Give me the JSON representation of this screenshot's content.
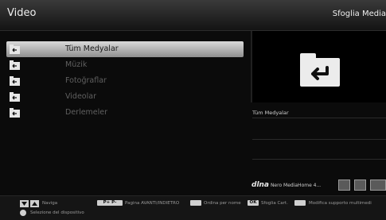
{
  "header": {
    "title": "Video",
    "right": "Sfoglia Media"
  },
  "menu": [
    {
      "label": "Tüm Medyalar",
      "selected": true
    },
    {
      "label": "Müzik",
      "selected": false
    },
    {
      "label": "Fotoğraflar",
      "selected": false
    },
    {
      "label": "Videolar",
      "selected": false
    },
    {
      "label": "Derlemeler",
      "selected": false
    }
  ],
  "preview": {
    "title": "Tüm Medyalar"
  },
  "dlna": {
    "brand": "dlna",
    "server": "Nero MediaHome 4..."
  },
  "footer": {
    "navigate": "Naviga",
    "pminus_key": "P+ P-",
    "page": "Pagina AVANTI/INDIETRO",
    "sort": "Ordina per nome",
    "ok_key": "OK",
    "browse": "Sfoglia Cart.",
    "modify": "Modifica supporto multimedi",
    "select_device": "Selezione del dispositivo"
  }
}
